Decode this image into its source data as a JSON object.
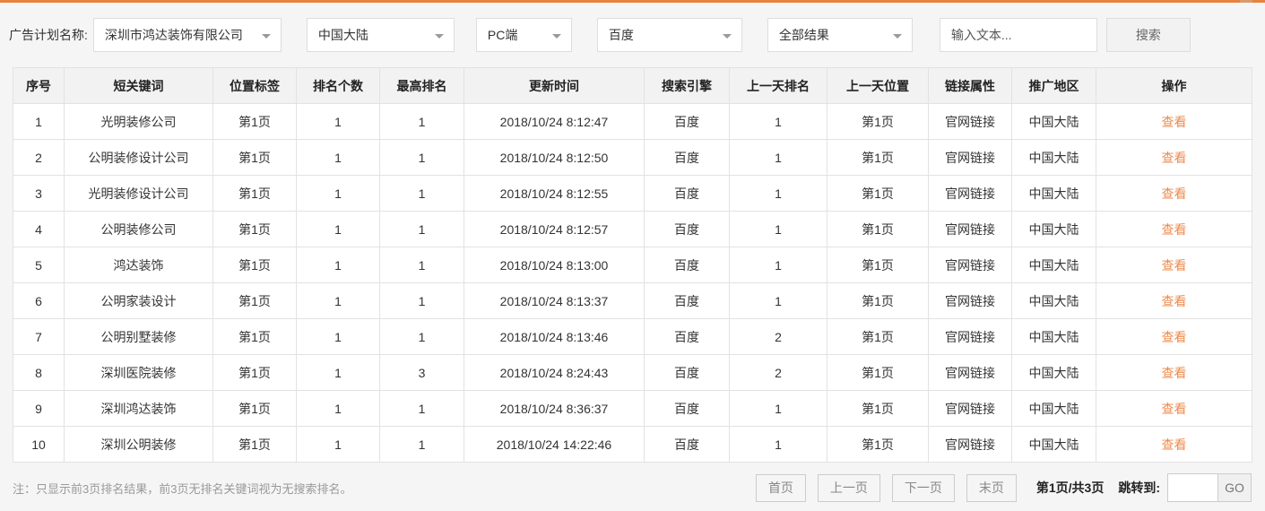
{
  "accent": {
    "top_bar_color": "#e8823d",
    "link_color": "#ed8a4c"
  },
  "filter_bar": {
    "label": "广告计划名称:",
    "plan": {
      "value": "深圳市鸿达装饰有限公司"
    },
    "region": {
      "value": "中国大陆"
    },
    "device": {
      "value": "PC端"
    },
    "engine": {
      "value": "百度"
    },
    "result": {
      "value": "全部结果"
    },
    "search_input": {
      "placeholder": "输入文本..."
    },
    "search_button": "搜索"
  },
  "table": {
    "headers": [
      "序号",
      "短关键词",
      "位置标签",
      "排名个数",
      "最高排名",
      "更新时间",
      "搜索引擎",
      "上一天排名",
      "上一天位置",
      "链接属性",
      "推广地区",
      "操作"
    ],
    "action_label": "查看",
    "rows": [
      [
        "1",
        "光明装修公司",
        "第1页",
        "1",
        "1",
        "2018/10/24 8:12:47",
        "百度",
        "1",
        "第1页",
        "官网链接",
        "中国大陆"
      ],
      [
        "2",
        "公明装修设计公司",
        "第1页",
        "1",
        "1",
        "2018/10/24 8:12:50",
        "百度",
        "1",
        "第1页",
        "官网链接",
        "中国大陆"
      ],
      [
        "3",
        "光明装修设计公司",
        "第1页",
        "1",
        "1",
        "2018/10/24 8:12:55",
        "百度",
        "1",
        "第1页",
        "官网链接",
        "中国大陆"
      ],
      [
        "4",
        "公明装修公司",
        "第1页",
        "1",
        "1",
        "2018/10/24 8:12:57",
        "百度",
        "1",
        "第1页",
        "官网链接",
        "中国大陆"
      ],
      [
        "5",
        "鸿达装饰",
        "第1页",
        "1",
        "1",
        "2018/10/24 8:13:00",
        "百度",
        "1",
        "第1页",
        "官网链接",
        "中国大陆"
      ],
      [
        "6",
        "公明家装设计",
        "第1页",
        "1",
        "1",
        "2018/10/24 8:13:37",
        "百度",
        "1",
        "第1页",
        "官网链接",
        "中国大陆"
      ],
      [
        "7",
        "公明别墅装修",
        "第1页",
        "1",
        "1",
        "2018/10/24 8:13:46",
        "百度",
        "2",
        "第1页",
        "官网链接",
        "中国大陆"
      ],
      [
        "8",
        "深圳医院装修",
        "第1页",
        "1",
        "3",
        "2018/10/24 8:24:43",
        "百度",
        "2",
        "第1页",
        "官网链接",
        "中国大陆"
      ],
      [
        "9",
        "深圳鸿达装饰",
        "第1页",
        "1",
        "1",
        "2018/10/24 8:36:37",
        "百度",
        "1",
        "第1页",
        "官网链接",
        "中国大陆"
      ],
      [
        "10",
        "深圳公明装修",
        "第1页",
        "1",
        "1",
        "2018/10/24 14:22:46",
        "百度",
        "1",
        "第1页",
        "官网链接",
        "中国大陆"
      ]
    ]
  },
  "footer": {
    "note": "注：只显示前3页排名结果，前3页无排名关键词视为无搜索排名。",
    "pagination": {
      "first": "首页",
      "prev": "上一页",
      "next": "下一页",
      "last": "末页",
      "page_info": "第1页/共3页",
      "jump_label": "跳转到:",
      "go": "GO"
    }
  }
}
